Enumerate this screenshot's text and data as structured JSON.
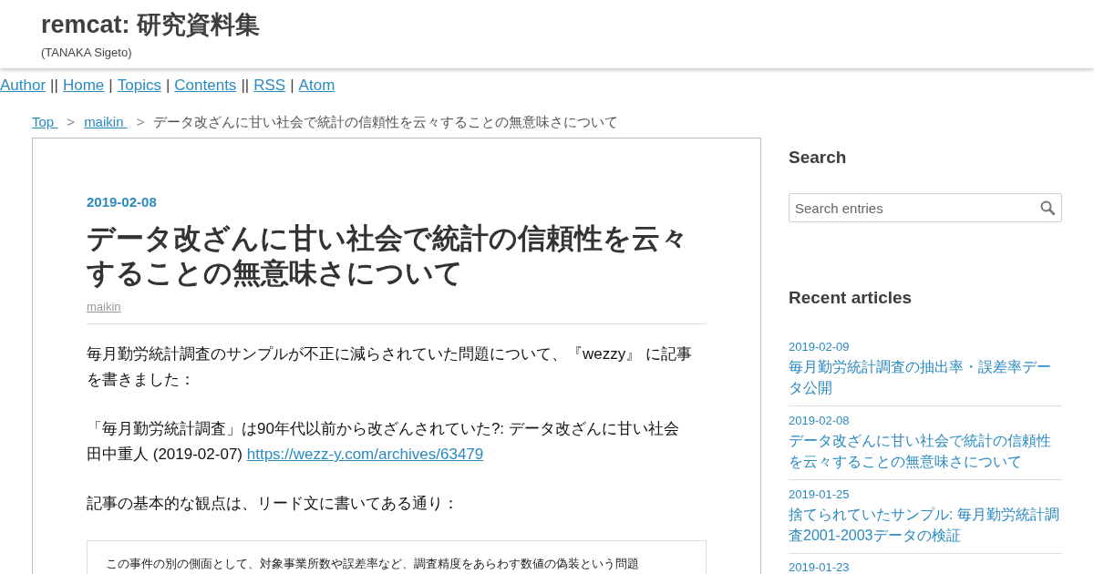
{
  "header": {
    "title": "remcat: 研究資料集",
    "subtitle": "(TANAKA Sigeto)"
  },
  "nav": [
    {
      "kind": "link",
      "text": "Author"
    },
    {
      "kind": "separator",
      "text": "||"
    },
    {
      "kind": "link",
      "text": "Home"
    },
    {
      "kind": "separator",
      "text": "|"
    },
    {
      "kind": "link",
      "text": "Topics"
    },
    {
      "kind": "separator",
      "text": "|"
    },
    {
      "kind": "link",
      "text": "Contents"
    },
    {
      "kind": "separator",
      "text": "||"
    },
    {
      "kind": "link",
      "text": "RSS"
    },
    {
      "kind": "separator",
      "text": "|"
    },
    {
      "kind": "link",
      "text": "Atom"
    }
  ],
  "breadcrumb": [
    {
      "kind": "link",
      "text": "Top"
    },
    {
      "kind": "separator",
      "text": ">"
    },
    {
      "kind": "link",
      "text": "maikin"
    },
    {
      "kind": "separator",
      "text": ">"
    },
    {
      "kind": "current",
      "text": "データ改ざんに甘い社会で統計の信頼性を云々することの無意味さについて"
    }
  ],
  "article": {
    "date": "2019-02-08",
    "title": "データ改ざんに甘い社会で統計の信頼性を云々することの無意味さについて",
    "category": "maikin",
    "body": [
      {
        "kind": "paragraph",
        "text": "毎月勤労統計調査のサンプルが不正に減らされていた問題について、『wezzy』 に記事を書きました："
      },
      {
        "kind": "citation",
        "title": "「毎月勤労統計調査」は90年代以前から改ざんされていた?: データ改ざんに甘い社会",
        "byline": "田中重人 (2019-02-07)",
        "url": "https://wezz-y.com/archives/63479"
      },
      {
        "kind": "paragraph",
        "text": "記事の基本的な観点は、リード文に書いてある通り："
      },
      {
        "kind": "quote",
        "text": "この事件の別の側面として、対象事業所数や誤差率など、調査精度をあらわす数値の偽装という問題"
      }
    ]
  },
  "sidebar": {
    "search": {
      "heading": "Search",
      "placeholder": "Search entries"
    },
    "recent": {
      "heading": "Recent articles",
      "items": [
        {
          "date": "2019-02-09",
          "title": "毎月勤労統計調査の抽出率・誤差率データ公開"
        },
        {
          "date": "2019-02-08",
          "title": "データ改ざんに甘い社会で統計の信頼性を云々することの無意味さについて"
        },
        {
          "date": "2019-01-25",
          "title": "捨てられていたサンプル: 毎月勤労統計調査2001-2003データの検証"
        },
        {
          "date": "2019-01-23"
        }
      ]
    }
  }
}
